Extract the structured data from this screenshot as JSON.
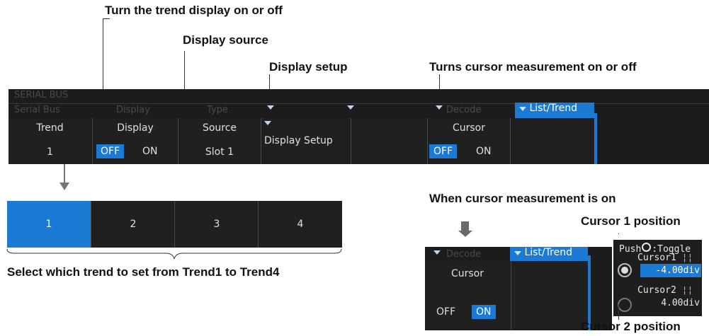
{
  "callouts": {
    "trend_onoff": "Turn the trend display on or off",
    "display_source": "Display source",
    "display_setup": "Display setup",
    "cursor_onoff": "Turns cursor measurement on or off",
    "when_cursor_on": "When cursor measurement is on",
    "cursor1_pos": "Cursor 1 position",
    "cursor2_pos": "Cursor 2 position",
    "select_trend": "Select which trend to set from Trend1 to Trend4"
  },
  "menu": {
    "strip_title": "SERIAL BUS",
    "strip_tabs": [
      "Serial Bus",
      "Display",
      "Type",
      "",
      "",
      "Decode"
    ],
    "active_tab": "List/Trend",
    "cells": {
      "trend": {
        "title": "Trend",
        "value": "1"
      },
      "display": {
        "title": "Display",
        "off": "OFF",
        "on": "ON",
        "selected": "OFF"
      },
      "source": {
        "title": "Source",
        "value": "Slot 1"
      },
      "setup": {
        "title": "Display Setup"
      },
      "cursor": {
        "title": "Cursor",
        "off": "OFF",
        "on": "ON",
        "selected": "OFF"
      }
    }
  },
  "trend_select": {
    "options": [
      "1",
      "2",
      "3",
      "4"
    ],
    "selected": "1"
  },
  "cursor_on_panel": {
    "tab_decode": "Decode",
    "active_tab": "List/Trend",
    "title": "Cursor",
    "off": "OFF",
    "on": "ON",
    "selected": "ON",
    "push_label": "Push",
    "toggle_label": ":Toggle",
    "cursor1_label": "Cursor1",
    "cursor1_value": "-4.00div",
    "cursor2_label": "Cursor2",
    "cursor2_value": "4.00div"
  },
  "colors": {
    "accent": "#1a7ad4",
    "panel": "#1c1c1c"
  }
}
